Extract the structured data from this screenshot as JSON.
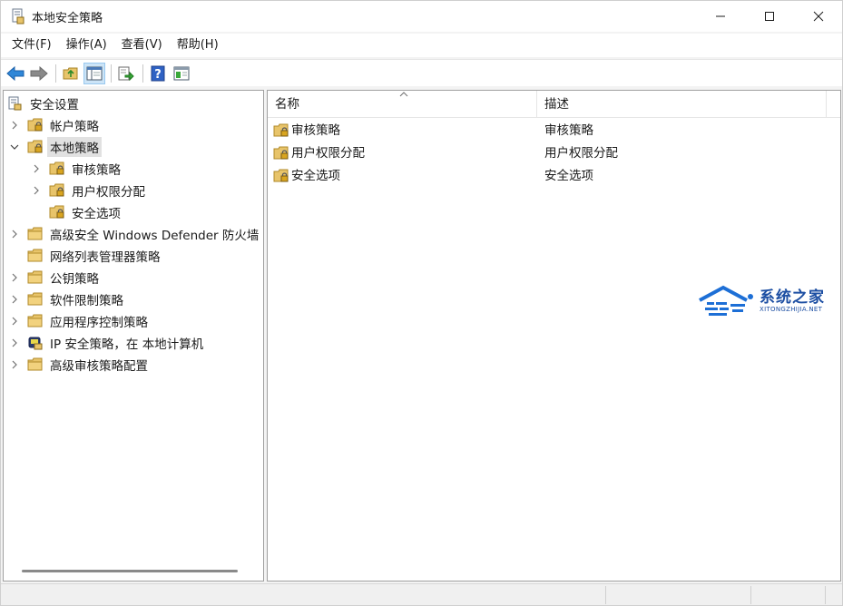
{
  "window": {
    "title": "本地安全策略"
  },
  "menu": {
    "items": [
      "文件(F)",
      "操作(A)",
      "查看(V)",
      "帮助(H)"
    ]
  },
  "toolbar": {
    "buttons": [
      "back-icon",
      "forward-icon",
      "up-folder-icon",
      "show-hide-tree-icon",
      "export-list-icon",
      "help-icon",
      "properties-pane-icon"
    ]
  },
  "tree": {
    "root": "安全设置",
    "items": [
      {
        "label": "帐户策略",
        "expanded": false
      },
      {
        "label": "本地策略",
        "expanded": true,
        "selected": true
      },
      {
        "label": "审核策略",
        "expanded": false
      },
      {
        "label": "用户权限分配",
        "expanded": false
      },
      {
        "label": "安全选项",
        "expanded": false
      },
      {
        "label": "高级安全 Windows Defender 防火墙",
        "expanded": false
      },
      {
        "label": "网络列表管理器策略",
        "expanded": false
      },
      {
        "label": "公钥策略",
        "expanded": false
      },
      {
        "label": "软件限制策略",
        "expanded": false
      },
      {
        "label": "应用程序控制策略",
        "expanded": false
      },
      {
        "label": "IP 安全策略，在 本地计算机",
        "expanded": false
      },
      {
        "label": "高级审核策略配置",
        "expanded": false
      }
    ]
  },
  "list": {
    "columns": [
      "名称",
      "描述"
    ],
    "rows": [
      {
        "name": "审核策略",
        "description": "审核策略"
      },
      {
        "name": "用户权限分配",
        "description": "用户权限分配"
      },
      {
        "name": "安全选项",
        "description": "安全选项"
      }
    ]
  },
  "watermark": {
    "text": "系统之家",
    "subtext": "XITONGZHIJIA.NET"
  },
  "colors": {
    "folder": "#e8c46a",
    "accent": "#1d6fd6",
    "selected_bg": "#e1e1e1"
  }
}
